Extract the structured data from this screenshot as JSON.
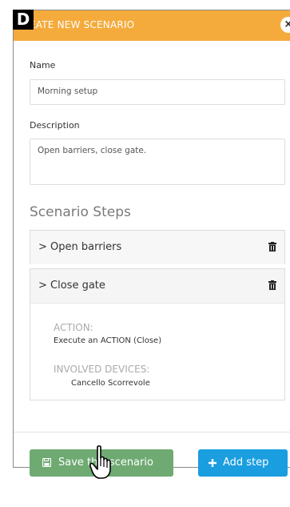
{
  "badge": "D",
  "modal": {
    "title": "EATE NEW SCENARIO",
    "close": "×"
  },
  "form": {
    "name_label": "Name",
    "name_value": "Morning setup",
    "description_label": "Description",
    "description_value": "Open barriers, close gate."
  },
  "steps_section": {
    "title": "Scenario Steps",
    "steps": [
      {
        "label": "> Open barriers",
        "expanded": false
      },
      {
        "label": "> Close gate",
        "expanded": true,
        "action_title": "ACTION:",
        "action_value": "Execute an ACTION (Close)",
        "devices_title": "INVOLVED DEVICES:",
        "devices_value": "Cancello Scorrevole"
      }
    ]
  },
  "footer": {
    "save_label": "Save this scenario",
    "add_label": "Add step"
  },
  "colors": {
    "header": "#f5ab3c",
    "save_button": "#6faa72",
    "add_button": "#1a9ee0"
  }
}
